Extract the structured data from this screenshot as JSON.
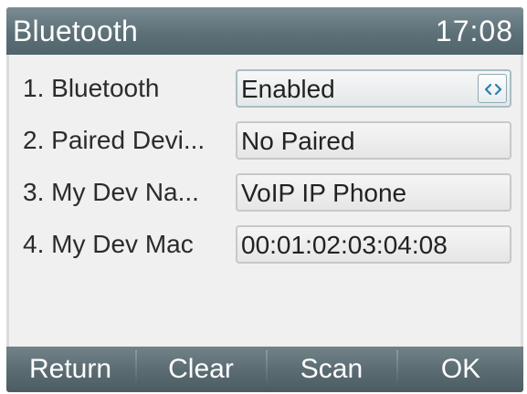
{
  "header": {
    "title": "Bluetooth",
    "time": "17:08"
  },
  "rows": [
    {
      "number": "1.",
      "label": "Bluetooth",
      "value": "Enabled",
      "has_switch": true,
      "switch_icon": "left-right-chevrons-icon"
    },
    {
      "number": "2.",
      "label": "Paired Devi...",
      "value": "No Paired"
    },
    {
      "number": "3.",
      "label": "My Dev Na...",
      "value": "VoIP IP Phone"
    },
    {
      "number": "4.",
      "label": "My Dev Mac",
      "value": "00:01:02:03:04:08"
    }
  ],
  "softkeys": [
    "Return",
    "Clear",
    "Scan",
    "OK"
  ],
  "colors": {
    "title_bar": "#5d7077",
    "softkey_bar": "#5b6d73",
    "background": "#f0f0f0",
    "switch_icon": "#2a7fb0"
  }
}
